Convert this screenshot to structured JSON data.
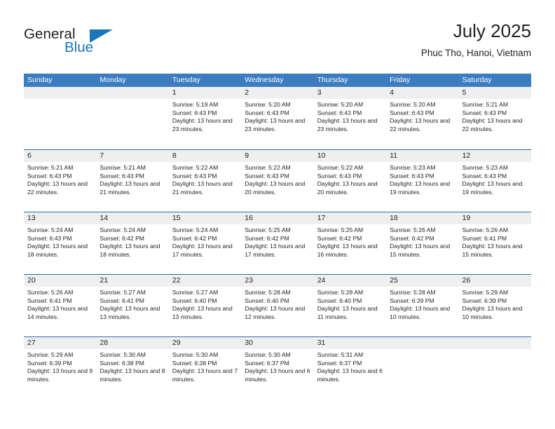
{
  "brand": {
    "name_top": "General",
    "name_bottom": "Blue",
    "accent_color": "#1b75bb"
  },
  "header": {
    "title": "July 2025",
    "subtitle": "Phuc Tho, Hanoi, Vietnam"
  },
  "theme": {
    "header_bar_color": "#3b7dc0",
    "row_divider_color": "#2e6da9",
    "day_band_color": "#efefef",
    "text_color": "#231f20"
  },
  "calendar": {
    "weekdays": [
      "Sunday",
      "Monday",
      "Tuesday",
      "Wednesday",
      "Thursday",
      "Friday",
      "Saturday"
    ],
    "weeks": [
      [
        {
          "day": "",
          "sunrise": "",
          "sunset": "",
          "daylight": "",
          "empty": true
        },
        {
          "day": "",
          "sunrise": "",
          "sunset": "",
          "daylight": "",
          "empty": true
        },
        {
          "day": "1",
          "sunrise": "Sunrise: 5:19 AM",
          "sunset": "Sunset: 6:43 PM",
          "daylight": "Daylight: 13 hours and 23 minutes."
        },
        {
          "day": "2",
          "sunrise": "Sunrise: 5:20 AM",
          "sunset": "Sunset: 6:43 PM",
          "daylight": "Daylight: 13 hours and 23 minutes."
        },
        {
          "day": "3",
          "sunrise": "Sunrise: 5:20 AM",
          "sunset": "Sunset: 6:43 PM",
          "daylight": "Daylight: 13 hours and 23 minutes."
        },
        {
          "day": "4",
          "sunrise": "Sunrise: 5:20 AM",
          "sunset": "Sunset: 6:43 PM",
          "daylight": "Daylight: 13 hours and 22 minutes."
        },
        {
          "day": "5",
          "sunrise": "Sunrise: 5:21 AM",
          "sunset": "Sunset: 6:43 PM",
          "daylight": "Daylight: 13 hours and 22 minutes."
        }
      ],
      [
        {
          "day": "6",
          "sunrise": "Sunrise: 5:21 AM",
          "sunset": "Sunset: 6:43 PM",
          "daylight": "Daylight: 13 hours and 22 minutes."
        },
        {
          "day": "7",
          "sunrise": "Sunrise: 5:21 AM",
          "sunset": "Sunset: 6:43 PM",
          "daylight": "Daylight: 13 hours and 21 minutes."
        },
        {
          "day": "8",
          "sunrise": "Sunrise: 5:22 AM",
          "sunset": "Sunset: 6:43 PM",
          "daylight": "Daylight: 13 hours and 21 minutes."
        },
        {
          "day": "9",
          "sunrise": "Sunrise: 5:22 AM",
          "sunset": "Sunset: 6:43 PM",
          "daylight": "Daylight: 13 hours and 20 minutes."
        },
        {
          "day": "10",
          "sunrise": "Sunrise: 5:22 AM",
          "sunset": "Sunset: 6:43 PM",
          "daylight": "Daylight: 13 hours and 20 minutes."
        },
        {
          "day": "11",
          "sunrise": "Sunrise: 5:23 AM",
          "sunset": "Sunset: 6:43 PM",
          "daylight": "Daylight: 13 hours and 19 minutes."
        },
        {
          "day": "12",
          "sunrise": "Sunrise: 5:23 AM",
          "sunset": "Sunset: 6:43 PM",
          "daylight": "Daylight: 13 hours and 19 minutes."
        }
      ],
      [
        {
          "day": "13",
          "sunrise": "Sunrise: 5:24 AM",
          "sunset": "Sunset: 6:43 PM",
          "daylight": "Daylight: 13 hours and 18 minutes."
        },
        {
          "day": "14",
          "sunrise": "Sunrise: 5:24 AM",
          "sunset": "Sunset: 6:42 PM",
          "daylight": "Daylight: 13 hours and 18 minutes."
        },
        {
          "day": "15",
          "sunrise": "Sunrise: 5:24 AM",
          "sunset": "Sunset: 6:42 PM",
          "daylight": "Daylight: 13 hours and 17 minutes."
        },
        {
          "day": "16",
          "sunrise": "Sunrise: 5:25 AM",
          "sunset": "Sunset: 6:42 PM",
          "daylight": "Daylight: 13 hours and 17 minutes."
        },
        {
          "day": "17",
          "sunrise": "Sunrise: 5:25 AM",
          "sunset": "Sunset: 6:42 PM",
          "daylight": "Daylight: 13 hours and 16 minutes."
        },
        {
          "day": "18",
          "sunrise": "Sunrise: 5:26 AM",
          "sunset": "Sunset: 6:42 PM",
          "daylight": "Daylight: 13 hours and 15 minutes."
        },
        {
          "day": "19",
          "sunrise": "Sunrise: 5:26 AM",
          "sunset": "Sunset: 6:41 PM",
          "daylight": "Daylight: 13 hours and 15 minutes."
        }
      ],
      [
        {
          "day": "20",
          "sunrise": "Sunrise: 5:26 AM",
          "sunset": "Sunset: 6:41 PM",
          "daylight": "Daylight: 13 hours and 14 minutes."
        },
        {
          "day": "21",
          "sunrise": "Sunrise: 5:27 AM",
          "sunset": "Sunset: 6:41 PM",
          "daylight": "Daylight: 13 hours and 13 minutes."
        },
        {
          "day": "22",
          "sunrise": "Sunrise: 5:27 AM",
          "sunset": "Sunset: 6:40 PM",
          "daylight": "Daylight: 13 hours and 13 minutes."
        },
        {
          "day": "23",
          "sunrise": "Sunrise: 5:28 AM",
          "sunset": "Sunset: 6:40 PM",
          "daylight": "Daylight: 13 hours and 12 minutes."
        },
        {
          "day": "24",
          "sunrise": "Sunrise: 5:28 AM",
          "sunset": "Sunset: 6:40 PM",
          "daylight": "Daylight: 13 hours and 11 minutes."
        },
        {
          "day": "25",
          "sunrise": "Sunrise: 5:28 AM",
          "sunset": "Sunset: 6:39 PM",
          "daylight": "Daylight: 13 hours and 10 minutes."
        },
        {
          "day": "26",
          "sunrise": "Sunrise: 5:29 AM",
          "sunset": "Sunset: 6:39 PM",
          "daylight": "Daylight: 13 hours and 10 minutes."
        }
      ],
      [
        {
          "day": "27",
          "sunrise": "Sunrise: 5:29 AM",
          "sunset": "Sunset: 6:39 PM",
          "daylight": "Daylight: 13 hours and 9 minutes."
        },
        {
          "day": "28",
          "sunrise": "Sunrise: 5:30 AM",
          "sunset": "Sunset: 6:38 PM",
          "daylight": "Daylight: 13 hours and 8 minutes."
        },
        {
          "day": "29",
          "sunrise": "Sunrise: 5:30 AM",
          "sunset": "Sunset: 6:38 PM",
          "daylight": "Daylight: 13 hours and 7 minutes."
        },
        {
          "day": "30",
          "sunrise": "Sunrise: 5:30 AM",
          "sunset": "Sunset: 6:37 PM",
          "daylight": "Daylight: 13 hours and 6 minutes."
        },
        {
          "day": "31",
          "sunrise": "Sunrise: 5:31 AM",
          "sunset": "Sunset: 6:37 PM",
          "daylight": "Daylight: 13 hours and 6 minutes."
        },
        {
          "day": "",
          "sunrise": "",
          "sunset": "",
          "daylight": "",
          "empty": true
        },
        {
          "day": "",
          "sunrise": "",
          "sunset": "",
          "daylight": "",
          "empty": true
        }
      ]
    ]
  }
}
